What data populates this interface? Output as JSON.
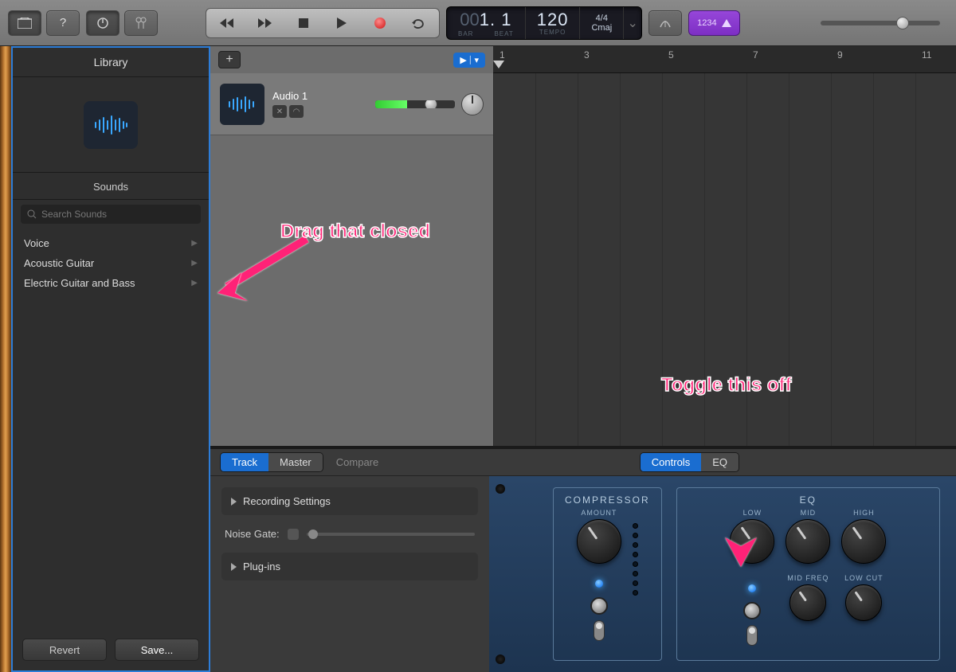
{
  "lcd": {
    "bar_dim": "00",
    "bar": "1",
    "beat": "1",
    "bar_lbl": "BAR",
    "beat_lbl": "BEAT",
    "tempo": "120",
    "tempo_lbl": "TEMPO",
    "sig": "4/4",
    "key": "Cmaj"
  },
  "count_in": "1234",
  "library": {
    "title": "Library",
    "sounds": "Sounds",
    "search_placeholder": "Search Sounds",
    "cats": [
      "Voice",
      "Acoustic Guitar",
      "Electric Guitar and Bass"
    ],
    "revert": "Revert",
    "save": "Save..."
  },
  "ruler": [
    "1",
    "3",
    "5",
    "7",
    "9",
    "11"
  ],
  "track": {
    "name": "Audio 1"
  },
  "smart": {
    "tabs": {
      "track": "Track",
      "master": "Master"
    },
    "compare": "Compare",
    "view": {
      "controls": "Controls",
      "eq": "EQ"
    },
    "rec": "Recording Settings",
    "ng": "Noise Gate:",
    "plugins": "Plug-ins",
    "comp": {
      "title": "COMPRESSOR",
      "amount": "AMOUNT"
    },
    "eq": {
      "title": "EQ",
      "low": "LOW",
      "mid": "MID",
      "high": "HIGH",
      "midfreq": "MID FREQ",
      "lowcut": "LOW CUT"
    }
  },
  "anno": {
    "drag": "Drag that closed",
    "toggle": "Toggle this off"
  }
}
